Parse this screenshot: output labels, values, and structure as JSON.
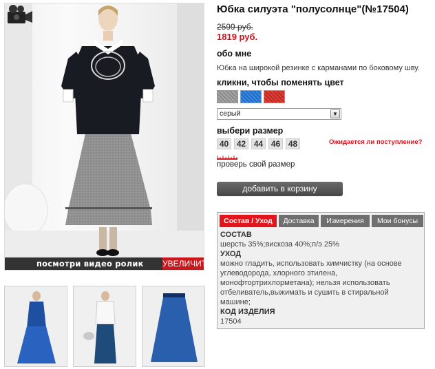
{
  "product": {
    "title": "Юбка силуэта \"полусолнце\"(№17504)",
    "old_price": "2599 руб.",
    "new_price": "1819 руб."
  },
  "about": {
    "label": "обо мне",
    "text": "Юбка на широкой резинке с карманами по боковому шву."
  },
  "color": {
    "label": "кликни, чтобы поменять цвет",
    "swatches": [
      "grey",
      "blue",
      "red"
    ],
    "selected": "серый"
  },
  "size": {
    "label": "выбери размер",
    "options": [
      "40",
      "42",
      "44",
      "46",
      "48"
    ],
    "notify_link": "Ожидается ли поступление?",
    "check_link": "проверь свой размер"
  },
  "cart_button": "добавить в корзину",
  "photo": {
    "video_label": "посмотри видео ролик",
    "zoom_label": "УВЕЛИЧИТЬ"
  },
  "tabs": [
    {
      "label": "Состав / Уход"
    },
    {
      "label": "Доставка"
    },
    {
      "label": "Измерения"
    },
    {
      "label": "Мои бонусы"
    }
  ],
  "composition": {
    "h1": "СОСТАВ",
    "t1": "шерсть 35%;вискоза 40%;п/э 25%",
    "h2": "УХОД",
    "t2_lines": [
      "можно гладить, использовать химчистку (на основе",
      "углеводорода, хлорного этилена,",
      "монофтортрихлорметана); нельзя использовать",
      "отбеливатель,выжимать и сушить в стиральной",
      "машине;"
    ],
    "h3": "КОД ИЗДЕЛИЯ",
    "t3": "17504"
  },
  "colors": {
    "accent_red": "#e2151c",
    "price_red": "#d3121b",
    "button_grey": "#555555"
  },
  "icons": [
    "video-camera-icon",
    "ruler-icon",
    "dropdown-arrow-icon"
  ]
}
